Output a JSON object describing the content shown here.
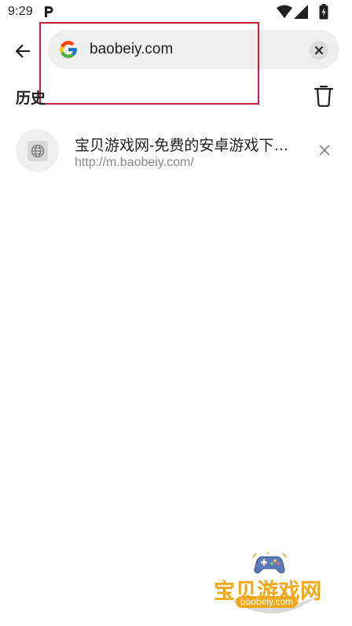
{
  "status_bar": {
    "time": "9:29",
    "icons": [
      "parking-notification-icon",
      "wifi-icon",
      "cell-signal-icon",
      "battery-icon"
    ]
  },
  "toolbar": {
    "back_icon": "arrow-left-icon",
    "search_engine_icon": "google-icon",
    "search_value": "baobeiy.com",
    "clear_icon": "close-icon"
  },
  "history": {
    "title": "历史",
    "clear_all_icon": "trash-icon",
    "items": [
      {
        "title": "宝贝游戏网-免费的安卓游戏下载网站",
        "url": "http://m.baobeiy.com/",
        "favicon": "globe-icon",
        "remove_icon": "close-icon"
      }
    ]
  },
  "watermark": {
    "title": "宝贝游戏网",
    "domain": "baobeiy.com"
  },
  "colors": {
    "highlight_box": "#c8203a",
    "omnibox_bg": "#efefef",
    "watermark_accent": "#f2a81d",
    "secondary_text": "#8a8a8a"
  }
}
